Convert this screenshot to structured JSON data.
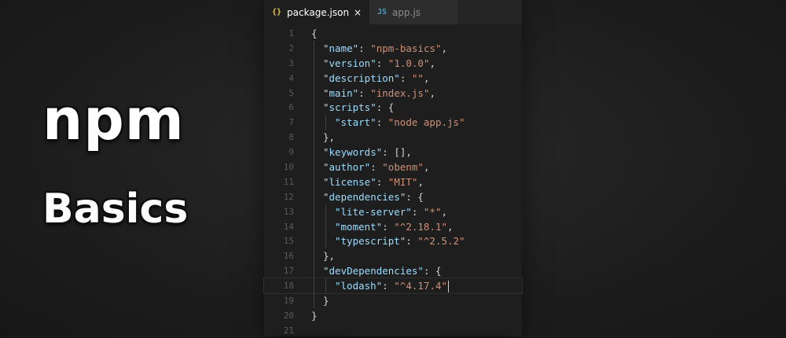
{
  "hero": {
    "title": "npm",
    "subtitle": "Basics"
  },
  "tabs": [
    {
      "icon": "{}",
      "label": "package.json",
      "close": "×",
      "active": true
    },
    {
      "icon": "JS",
      "label": "app.js",
      "active": false
    }
  ],
  "code_lines": [
    {
      "num": "1",
      "indent": 0,
      "parts": [
        [
          "punc",
          "{"
        ]
      ]
    },
    {
      "num": "2",
      "indent": 1,
      "parts": [
        [
          "key",
          "\"name\""
        ],
        [
          "punc",
          ": "
        ],
        [
          "str",
          "\"npm-basics\""
        ],
        [
          "punc",
          ","
        ]
      ]
    },
    {
      "num": "3",
      "indent": 1,
      "parts": [
        [
          "key",
          "\"version\""
        ],
        [
          "punc",
          ": "
        ],
        [
          "str",
          "\"1.0.0\""
        ],
        [
          "punc",
          ","
        ]
      ]
    },
    {
      "num": "4",
      "indent": 1,
      "parts": [
        [
          "key",
          "\"description\""
        ],
        [
          "punc",
          ": "
        ],
        [
          "str",
          "\"\""
        ],
        [
          "punc",
          ","
        ]
      ]
    },
    {
      "num": "5",
      "indent": 1,
      "parts": [
        [
          "key",
          "\"main\""
        ],
        [
          "punc",
          ": "
        ],
        [
          "str",
          "\"index.js\""
        ],
        [
          "punc",
          ","
        ]
      ]
    },
    {
      "num": "6",
      "indent": 1,
      "parts": [
        [
          "key",
          "\"scripts\""
        ],
        [
          "punc",
          ": {"
        ]
      ]
    },
    {
      "num": "7",
      "indent": 2,
      "parts": [
        [
          "key",
          "\"start\""
        ],
        [
          "punc",
          ": "
        ],
        [
          "str",
          "\"node app.js\""
        ]
      ]
    },
    {
      "num": "8",
      "indent": 1,
      "parts": [
        [
          "punc",
          "},"
        ]
      ]
    },
    {
      "num": "9",
      "indent": 1,
      "parts": [
        [
          "key",
          "\"keywords\""
        ],
        [
          "punc",
          ": [],"
        ]
      ]
    },
    {
      "num": "10",
      "indent": 1,
      "parts": [
        [
          "key",
          "\"author\""
        ],
        [
          "punc",
          ": "
        ],
        [
          "str",
          "\"obenm\""
        ],
        [
          "punc",
          ","
        ]
      ]
    },
    {
      "num": "11",
      "indent": 1,
      "parts": [
        [
          "key",
          "\"license\""
        ],
        [
          "punc",
          ": "
        ],
        [
          "str",
          "\"MIT\""
        ],
        [
          "punc",
          ","
        ]
      ]
    },
    {
      "num": "12",
      "indent": 1,
      "parts": [
        [
          "key",
          "\"dependencies\""
        ],
        [
          "punc",
          ": {"
        ]
      ]
    },
    {
      "num": "13",
      "indent": 2,
      "parts": [
        [
          "key",
          "\"lite-server\""
        ],
        [
          "punc",
          ": "
        ],
        [
          "str",
          "\"*\""
        ],
        [
          "punc",
          ","
        ]
      ]
    },
    {
      "num": "14",
      "indent": 2,
      "parts": [
        [
          "key",
          "\"moment\""
        ],
        [
          "punc",
          ": "
        ],
        [
          "str",
          "\"^2.18.1\""
        ],
        [
          "punc",
          ","
        ]
      ]
    },
    {
      "num": "15",
      "indent": 2,
      "parts": [
        [
          "key",
          "\"typescript\""
        ],
        [
          "punc",
          ": "
        ],
        [
          "str",
          "\"^2.5.2\""
        ]
      ]
    },
    {
      "num": "16",
      "indent": 1,
      "parts": [
        [
          "punc",
          "},"
        ]
      ]
    },
    {
      "num": "17",
      "indent": 1,
      "parts": [
        [
          "key",
          "\"devDependencies\""
        ],
        [
          "punc",
          ": {"
        ]
      ]
    },
    {
      "num": "18",
      "indent": 2,
      "parts": [
        [
          "key",
          "\"lodash\""
        ],
        [
          "punc",
          ": "
        ],
        [
          "str",
          "\"^4.17.4\""
        ]
      ],
      "cursor": true
    },
    {
      "num": "19",
      "indent": 1,
      "parts": [
        [
          "punc",
          "}"
        ]
      ]
    },
    {
      "num": "20",
      "indent": 0,
      "parts": [
        [
          "punc",
          "}"
        ]
      ]
    },
    {
      "num": "21",
      "indent": 0,
      "parts": []
    }
  ]
}
